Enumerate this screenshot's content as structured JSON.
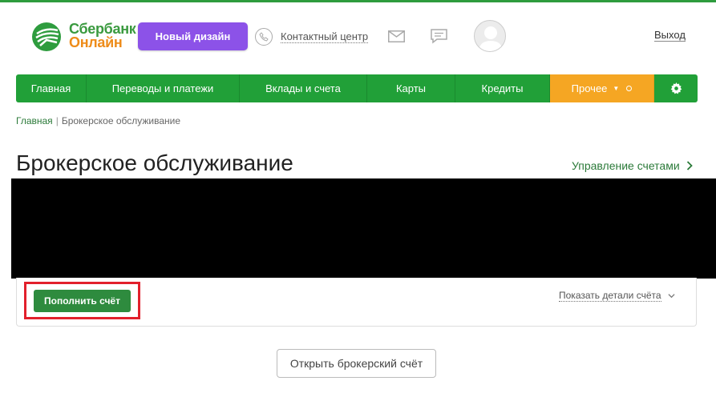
{
  "header": {
    "logo_line1": "Сбербанк",
    "logo_line2": "Онлайн",
    "new_design_label": "Новый дизайн",
    "contact_center_label": "Контактный центр",
    "logout_label": "Выход"
  },
  "nav": {
    "items": [
      {
        "label": "Главная"
      },
      {
        "label": "Переводы и платежи"
      },
      {
        "label": "Вклады и счета"
      },
      {
        "label": "Карты"
      },
      {
        "label": "Кредиты"
      },
      {
        "label": "Прочее"
      }
    ]
  },
  "breadcrumb": {
    "home": "Главная",
    "separator": "|",
    "current": "Брокерское обслуживание"
  },
  "main": {
    "title": "Брокерское обслуживание",
    "manage_accounts_label": "Управление счетами",
    "refill_button_label": "Пополнить счёт",
    "show_details_label": "Показать детали счёта",
    "open_broker_button_label": "Открыть брокерский счёт"
  },
  "colors": {
    "brand_green": "#21a038",
    "accent_orange": "#f5a623",
    "new_design_purple": "#8c52e8",
    "highlight_red": "#e2202c"
  }
}
